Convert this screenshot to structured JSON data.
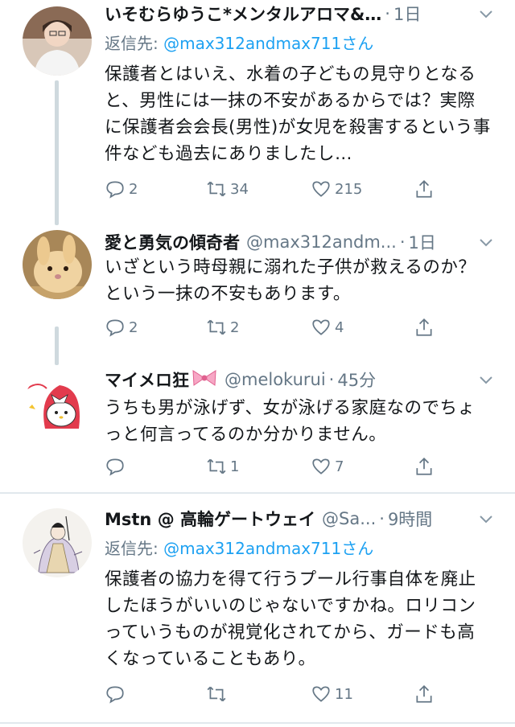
{
  "colors": {
    "link": "#1da1f2",
    "muted": "#657786",
    "line": "#cfd9de"
  },
  "tweets": [
    {
      "name": "いそむらゆうこ*メンタルアロマ&…",
      "handle": "",
      "time": "1日",
      "reply_prefix": "返信先: ",
      "reply_user": "@max312andmax711",
      "reply_suffix": "さん",
      "text": "保護者とはいえ、水着の子どもの見守りとなると、男性には一抹の不安があるからでは？実際に保護者会会長(男性)が女児を殺害するという事件なども過去にありましたし…",
      "replies": "2",
      "retweets": "34",
      "likes": "215"
    },
    {
      "name": "愛と勇気の傾奇者",
      "handle": "@max312andm...",
      "time": "1日",
      "text": "いざという時母親に溺れた子供が救えるのか？という一抹の不安もあります。",
      "replies": "2",
      "retweets": "2",
      "likes": "4"
    },
    {
      "name": "マイメロ狂",
      "handle": "@melokurui",
      "time": "45分",
      "text": "うちも男が泳げず、女が泳げる家庭なのでちょっと何言ってるのか分かりません。",
      "replies": "",
      "retweets": "1",
      "likes": "7"
    },
    {
      "name": "Mstn @ 高輪ゲートウェイ",
      "handle": "@Sa...",
      "time": "9時間",
      "reply_prefix": "返信先: ",
      "reply_user": "@max312andmax711",
      "reply_suffix": "さん",
      "text": "保護者の協力を得て行うプール行事自体を廃止したほうがいいのじゃないですかね。ロリコンっていうものが視覚化されてから、ガードも高くなっていることもあり。",
      "replies": "",
      "retweets": "",
      "likes": "11"
    }
  ]
}
